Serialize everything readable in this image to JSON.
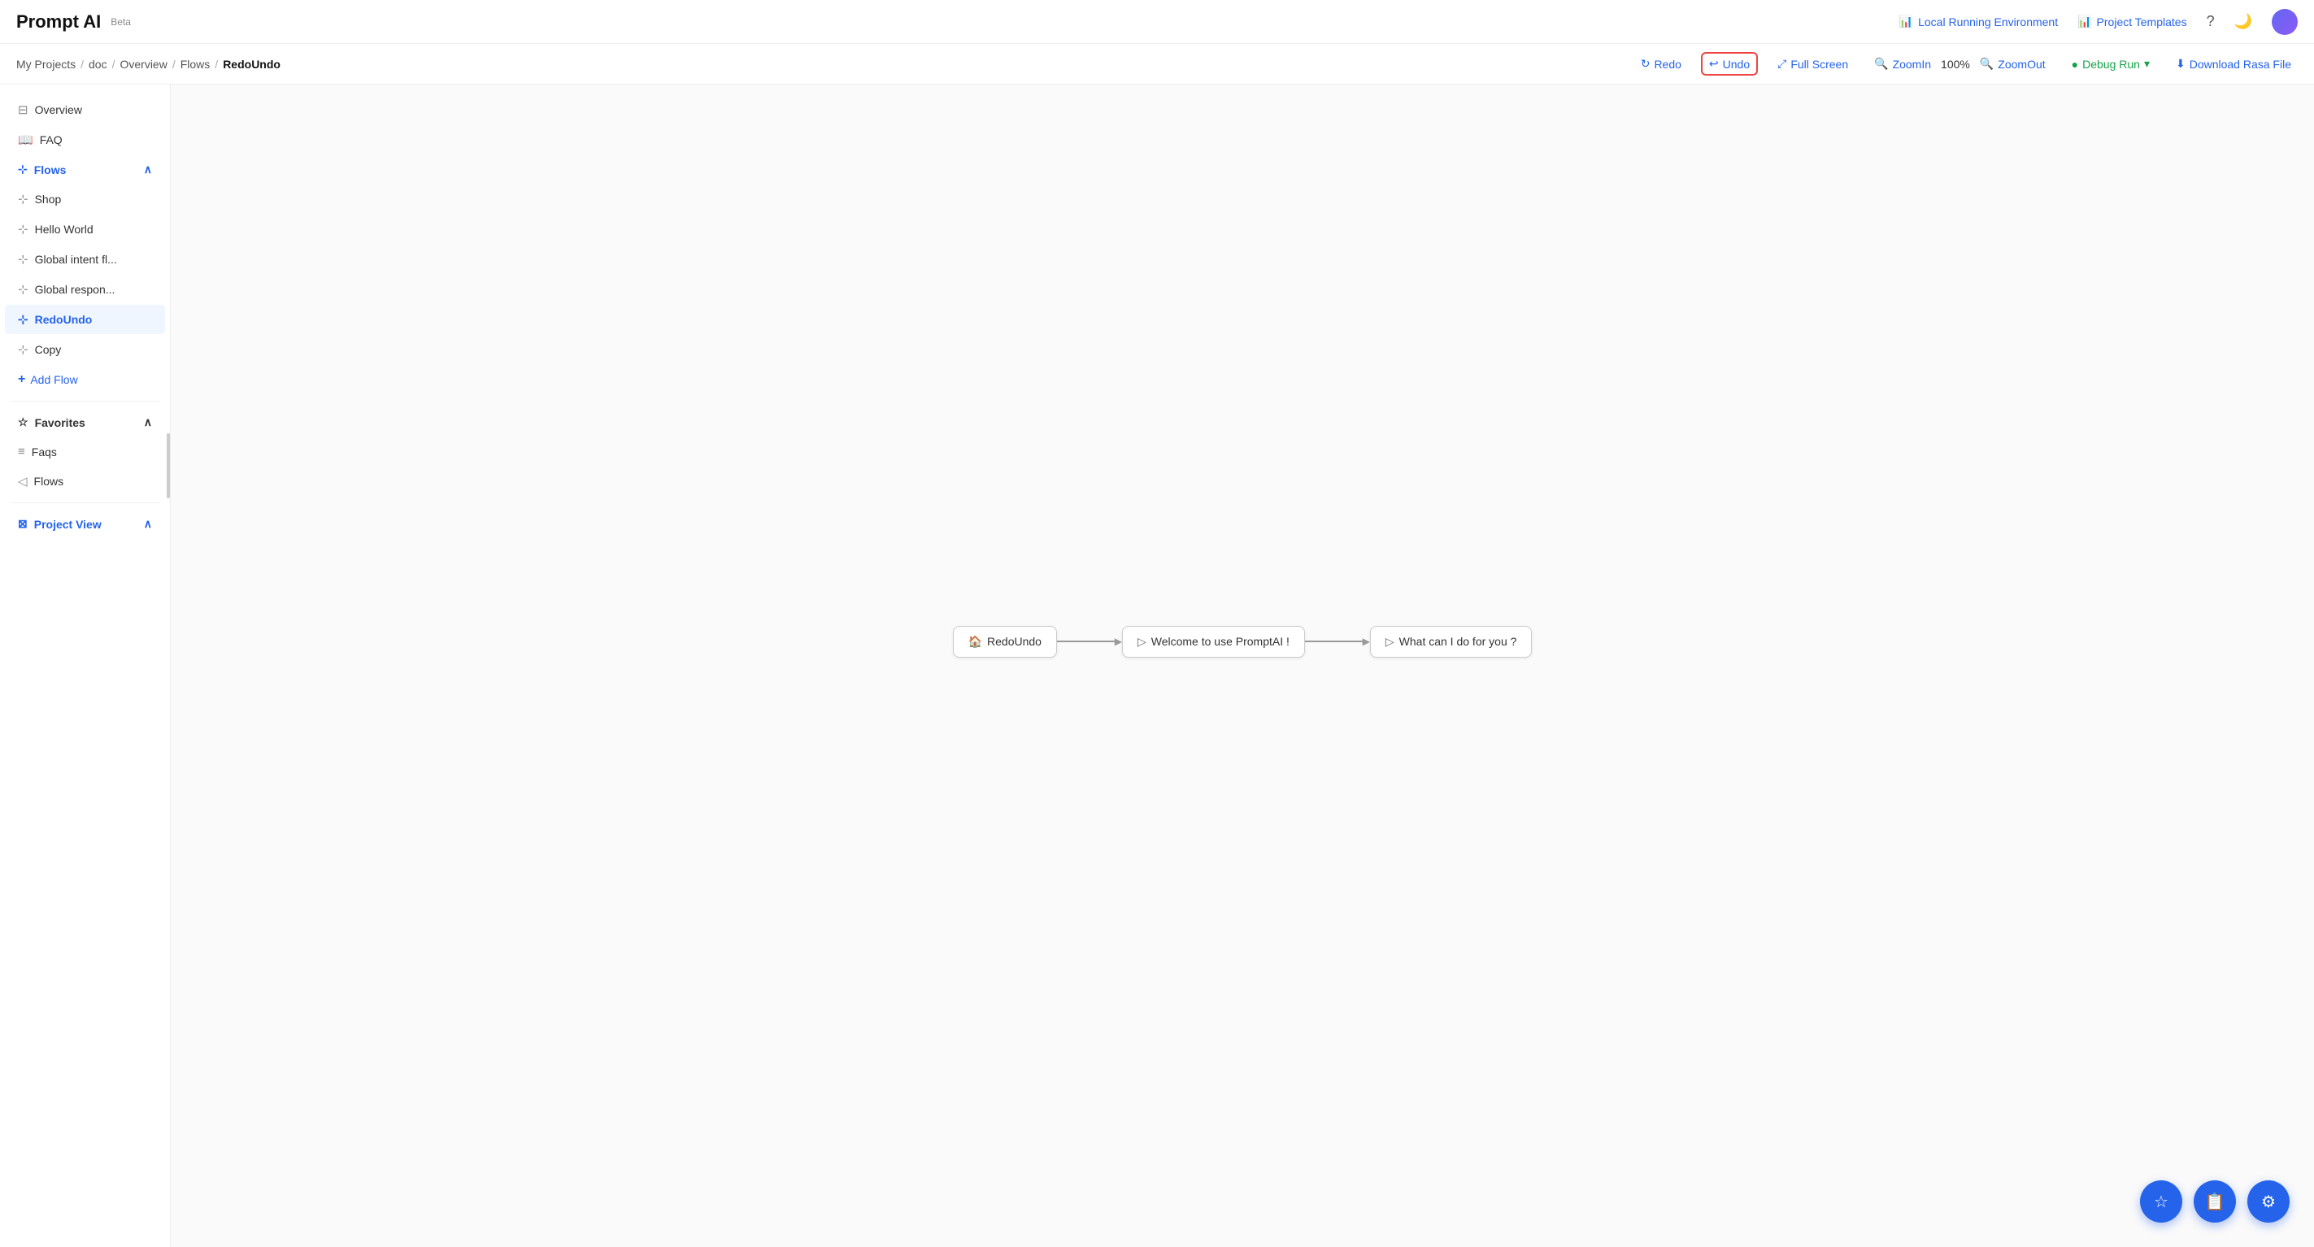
{
  "app": {
    "name": "Prompt AI",
    "beta_label": "Beta"
  },
  "top_nav": {
    "local_env_label": "Local Running Environment",
    "project_templates_label": "Project Templates",
    "help_icon": "?",
    "dark_mode_icon": "🌙"
  },
  "breadcrumb": {
    "items": [
      "My Projects",
      "doc",
      "Overview",
      "Flows"
    ],
    "current": "RedoUndo"
  },
  "toolbar": {
    "redo_label": "Redo",
    "undo_label": "Undo",
    "fullscreen_label": "Full Screen",
    "zoomin_label": "ZoomIn",
    "zoom_pct": "100%",
    "zoomout_label": "ZoomOut",
    "debug_label": "Debug Run",
    "download_label": "Download Rasa File"
  },
  "sidebar": {
    "overview_label": "Overview",
    "faq_label": "FAQ",
    "flows_label": "Flows",
    "flows_items": [
      {
        "label": "Shop"
      },
      {
        "label": "Hello World"
      },
      {
        "label": "Global intent fl..."
      },
      {
        "label": "Global respon..."
      },
      {
        "label": "RedoUndo",
        "active": true
      },
      {
        "label": "Copy"
      }
    ],
    "add_flow_label": "Add Flow",
    "favorites_label": "Favorites",
    "favorites_items": [
      {
        "label": "Faqs"
      },
      {
        "label": "Flows"
      }
    ],
    "project_view_label": "Project View"
  },
  "flow_diagram": {
    "nodes": [
      {
        "icon": "🏠",
        "label": "RedoUndo"
      },
      {
        "icon": "▷",
        "label": "Welcome to use PromptAI !"
      },
      {
        "icon": "▷",
        "label": "What can I do for you ?"
      }
    ]
  },
  "floating_btns": [
    {
      "icon": "☆",
      "name": "favorites-fab"
    },
    {
      "icon": "📋",
      "name": "copy-fab"
    },
    {
      "icon": "⚙",
      "name": "settings-fab"
    }
  ]
}
